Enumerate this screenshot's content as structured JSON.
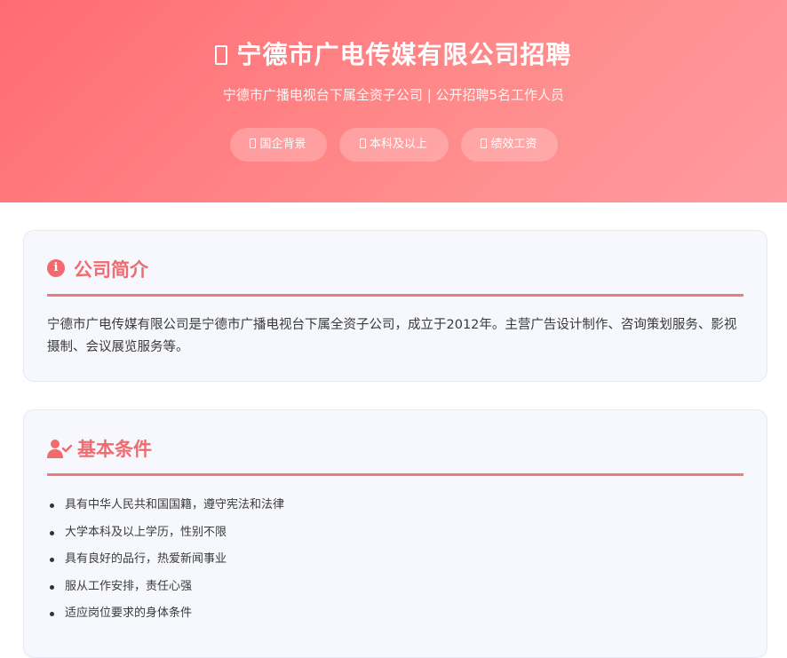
{
  "hero": {
    "title": "宁德市广电传媒有限公司招聘",
    "subtitle": "宁德市广播电视台下属全资子公司 | 公开招聘5名工作人员",
    "tags": [
      {
        "label": "国企背景",
        "icon": "box-glyph-icon"
      },
      {
        "label": "本科及以上",
        "icon": "box-glyph-icon"
      },
      {
        "label": "绩效工资",
        "icon": "box-glyph-icon"
      }
    ]
  },
  "intro": {
    "icon": "info-icon",
    "title": "公司简介",
    "text": "宁德市广电传媒有限公司是宁德市广播电视台下属全资子公司，成立于2012年。主营广告设计制作、咨询策划服务、影视摄制、会议展览服务等。"
  },
  "requirements": {
    "icon": "user-check-icon",
    "title": "基本条件",
    "items": [
      "具有中华人民共和国国籍，遵守宪法和法律",
      "大学本科及以上学历，性别不限",
      "具有良好的品行，热爱新闻事业",
      "服从工作安排，责任心强",
      "适应岗位要求的身体条件"
    ]
  },
  "colors": {
    "accent": "#f06a6e",
    "hero_start": "#ff6b72",
    "hero_end": "#ff9aa0",
    "card_bg": "#f7f8fd"
  }
}
